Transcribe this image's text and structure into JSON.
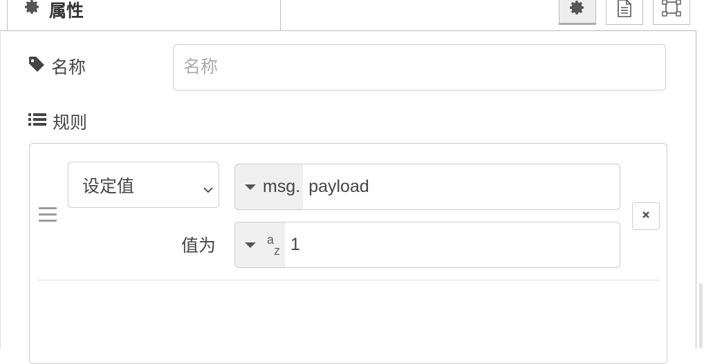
{
  "tab": {
    "label": "属性",
    "icon": "gear-icon"
  },
  "tab_buttons": [
    {
      "name": "settings",
      "icon": "gear-icon",
      "selected": true
    },
    {
      "name": "description",
      "icon": "document-icon",
      "selected": false
    },
    {
      "name": "appearance",
      "icon": "frame-icon",
      "selected": false
    }
  ],
  "name_field": {
    "label": "名称",
    "placeholder": "名称",
    "value": ""
  },
  "rules": {
    "label": "规则",
    "items": [
      {
        "action": "设定值",
        "target": {
          "type_label": "msg.",
          "value": "payload"
        },
        "value_label": "值为",
        "value": {
          "type": "string",
          "value": "1"
        }
      }
    ]
  },
  "colors": {
    "accent_bg": "#efefef",
    "border": "#cccccc",
    "text": "#444444"
  }
}
